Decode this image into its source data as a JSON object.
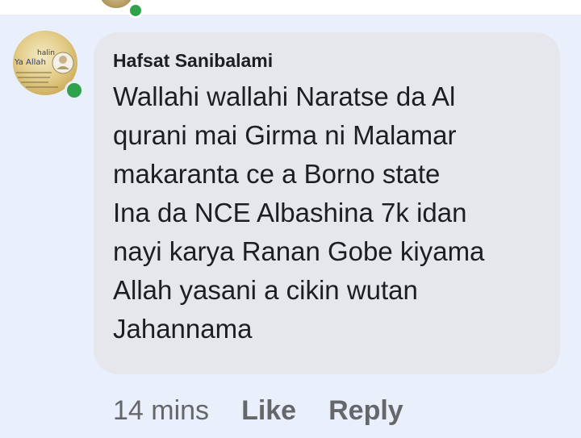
{
  "comment": {
    "author": "Hafsat Sanibalami",
    "text": "Wallahi wallahi Naratse da Al\nqurani mai Girma ni Malamar\nmakaranta ce a Borno state\nIna da NCE Albashina 7k idan\nnayi karya Ranan Gobe kiyama\nAllah yasani a cikin wutan\nJahannama",
    "timestamp": "14 mins",
    "like_label": "Like",
    "reply_label": "Reply"
  },
  "avatar_text": {
    "line1": "halin",
    "line2": "Ya Allah"
  },
  "colors": {
    "background": "#e9f0fb",
    "bubble": "#e5e7ec",
    "online": "#31a24c",
    "text": "#1c1e21",
    "muted": "#65676b"
  }
}
